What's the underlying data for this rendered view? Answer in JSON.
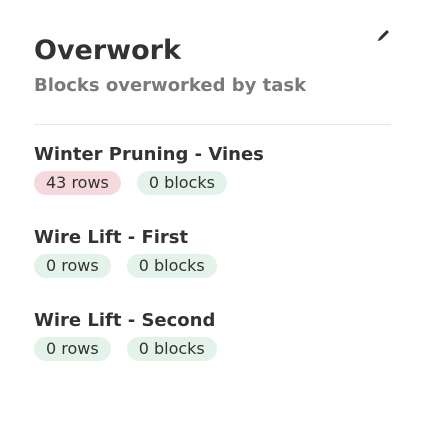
{
  "widget": {
    "title": "Overwork",
    "subtitle": "Blocks overworked by task",
    "edit_icon": "pencil-icon"
  },
  "tasks": [
    {
      "name": "Winter Pruning - Vines",
      "rows": "43 rows",
      "blocks": "0 blocks",
      "rows_status": "warning"
    },
    {
      "name": "Wire Lift - First",
      "rows": "0 rows",
      "blocks": "0 blocks",
      "rows_status": "ok"
    },
    {
      "name": "Wire Lift - Second",
      "rows": "0 rows",
      "blocks": "0 blocks",
      "rows_status": "ok"
    }
  ],
  "colors": {
    "warning_chip": "#f6d9dd",
    "ok_chip": "#e4f3ea",
    "text": "#333333",
    "subtitle": "#7a7a7a"
  }
}
